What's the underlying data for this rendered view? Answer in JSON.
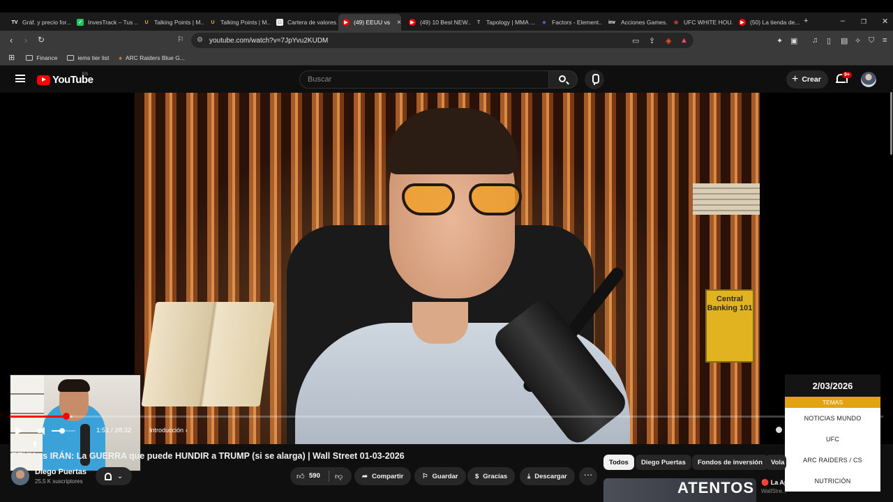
{
  "browser": {
    "tabs": [
      {
        "label": "Gráf. y precio for...",
        "icon": "TV",
        "color": "#2a2a2a"
      },
      {
        "label": "InvesTrack – Tus ...",
        "icon": "✓",
        "color": "#22c55e"
      },
      {
        "label": "Talking Points | M...",
        "icon": "U",
        "color": "#f0b429"
      },
      {
        "label": "Talking Points | M...",
        "icon": "U",
        "color": "#f0b429"
      },
      {
        "label": "Cartera de valores...",
        "icon": "□",
        "color": "#eeeeee"
      },
      {
        "label": "(49) EEUU vs",
        "icon": "▶",
        "color": "#ff0000"
      },
      {
        "label": "(49) 10 Best NEW...",
        "icon": "▶",
        "color": "#ff0000"
      },
      {
        "label": "Tapology | MMA ...",
        "icon": "T",
        "color": "#444444"
      },
      {
        "label": "Factors - Element...",
        "icon": "◆",
        "color": "#3b5bdb"
      },
      {
        "label": "Acciones Games...",
        "icon": "inv",
        "color": "#444444"
      },
      {
        "label": "UFC WHITE HOU...",
        "icon": "◉",
        "color": "#cc3333"
      },
      {
        "label": "(50) La tienda de...",
        "icon": "▶",
        "color": "#ff0000"
      }
    ],
    "url": "youtube.com/watch?v=7JpYvu2KUDM",
    "bookmarks": [
      "Finance",
      "iems tier list",
      "ARC Raiders Blue G..."
    ]
  },
  "youtube": {
    "logo": "YouTube",
    "region": "ES",
    "search_placeholder": "Buscar",
    "create_label": "Crear",
    "notif_count": "9+"
  },
  "player": {
    "time": "1:51 / 28:32",
    "chapter": "Introducción",
    "progress": 0.065,
    "volume": 0.45
  },
  "overlay": {
    "date": "2/03/2026",
    "header": "TEMAS",
    "items": [
      "NOTICIAS MUNDO",
      "UFC",
      "ARC RAIDERS / CS",
      "NUTRICIÓN"
    ]
  },
  "book_title": "Central Banking 101",
  "video": {
    "title": "EEUU vs IRÁN: La GUERRA que puede HUNDIR a TRUMP (si se alarga) | Wall Street 01-03-2026",
    "channel": "Diego Puertas",
    "subscribers": "25,5 K suscriptores",
    "likes": "590",
    "share": "Compartir",
    "save": "Guardar",
    "thanks": "Gracias",
    "download": "Descargar"
  },
  "chips": [
    "Todos",
    "Diego Puertas",
    "Fondos de inversión",
    "Vola"
  ],
  "side": {
    "thumb_text": "ATENTOS",
    "title": "🔴 La Ap...",
    "subtitle": "WallStre..."
  }
}
